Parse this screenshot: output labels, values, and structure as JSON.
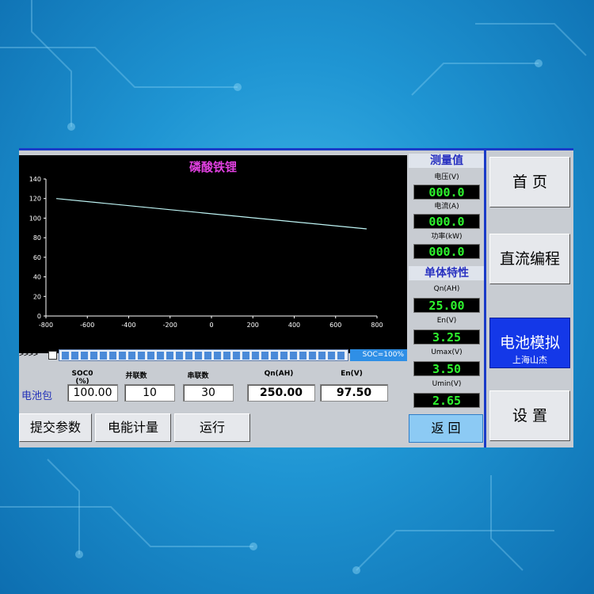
{
  "colors": {
    "screen_bg": "#c8ccd2",
    "accent_blue": "#1438e8",
    "lcd_green": "#2ef52e",
    "title_magenta": "#e040e0"
  },
  "chart_data": {
    "type": "line",
    "title": "磷酸铁锂",
    "xlabel": "",
    "ylabel": "",
    "xlim": [
      -800,
      800
    ],
    "ylim": [
      0,
      140
    ],
    "xticks": [
      -800,
      -600,
      -400,
      -200,
      0,
      200,
      400,
      600,
      800
    ],
    "yticks": [
      0,
      20,
      40,
      60,
      80,
      100,
      120,
      140
    ],
    "grid": false,
    "series": [
      {
        "color": "#bff5f5",
        "x": [
          -750,
          750
        ],
        "y": [
          120,
          89
        ]
      }
    ]
  },
  "soc": {
    "arrows": ">>>>",
    "label": "SOC=100%",
    "segments": 30
  },
  "params": {
    "soc0_header": "SOC0 (%)",
    "soc0": "100.00",
    "parallel_header": "并联数",
    "parallel": "10",
    "series_header": "串联数",
    "series": "30",
    "qn_header": "Qn(AH)",
    "qn": "250.00",
    "en_header": "En(V)",
    "en": "97.50",
    "pack_label": "电池包"
  },
  "actions": {
    "submit": "提交参数",
    "energy": "电能计量",
    "run": "运行"
  },
  "measure": {
    "title": "测量值",
    "voltage_label": "电压(V)",
    "voltage": "000.0",
    "current_label": "电流(A)",
    "current": "000.0",
    "power_label": "功率(kW)",
    "power": "000.0",
    "cell_title": "单体特性",
    "qn_label": "Qn(AH)",
    "qn": "25.00",
    "en_label": "En(V)",
    "en": "3.25",
    "umax_label": "Umax(V)",
    "umax": "3.50",
    "umin_label": "Umin(V)",
    "umin": "2.65",
    "back": "返 回"
  },
  "nav": {
    "home": "首 页",
    "dc": "直流编程",
    "battery": "电池模拟",
    "battery_sub": "上海山杰",
    "settings": "设 置"
  }
}
